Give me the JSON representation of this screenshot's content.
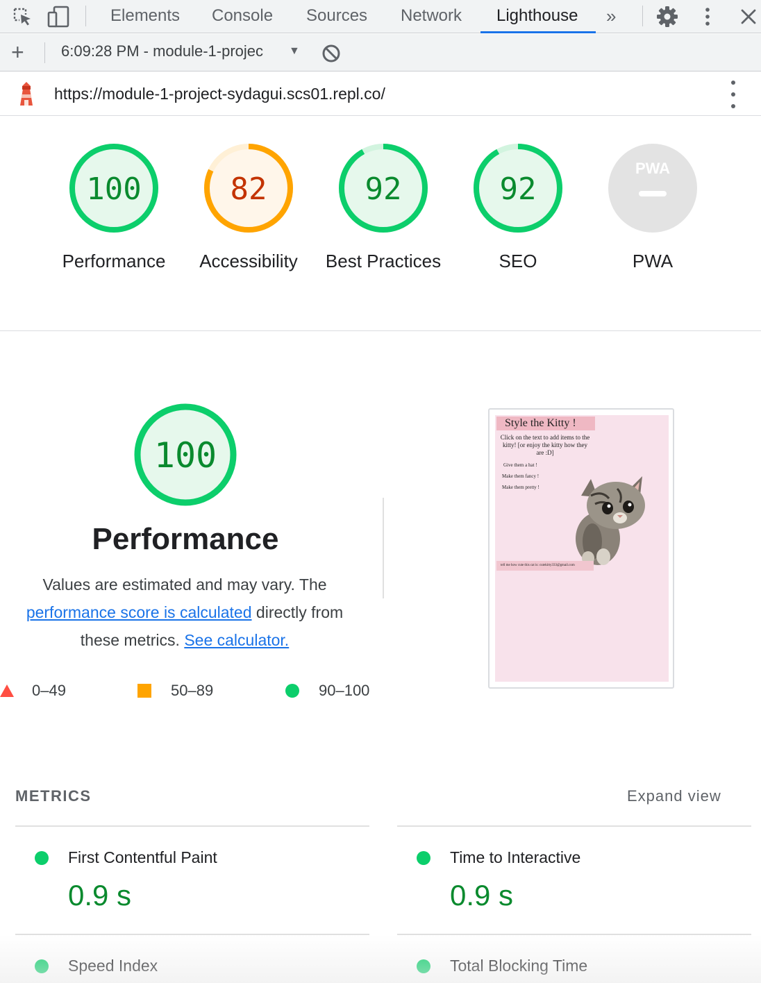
{
  "devtools": {
    "tabs": [
      {
        "label": "Elements"
      },
      {
        "label": "Console"
      },
      {
        "label": "Sources"
      },
      {
        "label": "Network"
      },
      {
        "label": "Lighthouse"
      }
    ],
    "more_tabs_glyph": "»",
    "active_tab": "Lighthouse",
    "icons": [
      "inspect-element-icon",
      "device-toolbar-icon",
      "chevron-double-right-icon",
      "gear-icon",
      "kebab-menu-icon",
      "close-icon"
    ]
  },
  "lighthouse_toolbar": {
    "add_glyph": "+",
    "report_select": "6:09:28 PM - module-1-projec",
    "clear_icon": "block-icon"
  },
  "url_bar": {
    "url": "https://module-1-project-sydagui.scs01.repl.co/"
  },
  "scores": [
    {
      "value": "100",
      "label": "Performance",
      "score": 100,
      "status": "pass"
    },
    {
      "value": "82",
      "label": "Accessibility",
      "score": 82,
      "status": "average"
    },
    {
      "value": "92",
      "label": "Best Practices",
      "score": 92,
      "status": "pass"
    },
    {
      "value": "92",
      "label": "SEO",
      "score": 92,
      "status": "pass"
    },
    {
      "value": "",
      "label": "PWA",
      "badge": "PWA",
      "status": "na"
    }
  ],
  "performance": {
    "score": "100",
    "title": "Performance",
    "desc_prefix": "Values are estimated and may vary. The ",
    "desc_link1": "performance score is calculated",
    "desc_middle": " directly from these metrics. ",
    "desc_link2": "See calculator."
  },
  "legend": [
    {
      "range": "0–49",
      "shape": "triangle",
      "color": "#ff4e42"
    },
    {
      "range": "50–89",
      "shape": "square",
      "color": "#ffa400"
    },
    {
      "range": "90–100",
      "shape": "circle",
      "color": "#0cce6b"
    }
  ],
  "thumbnail": {
    "title": "Style the Kitty !",
    "intro": "Click on the text to add items to the kitty! [or enjoy the kitty how they are :D]",
    "items": [
      "Give them a hat !",
      "Make them fancy !",
      "Make them pretty !"
    ],
    "footer": "tell me how cute this cat is: cutekitty333@gmail.com"
  },
  "metrics": {
    "heading": "METRICS",
    "expand_label": "Expand view",
    "items": [
      {
        "label": "First Contentful Paint",
        "value": "0.9 s"
      },
      {
        "label": "Time to Interactive",
        "value": "0.9 s"
      },
      {
        "label": "Speed Index",
        "value": ""
      },
      {
        "label": "Total Blocking Time",
        "value": ""
      }
    ]
  },
  "colors": {
    "pass": "#0cce6b",
    "pass_text": "#0a8a2e",
    "average": "#ffa400",
    "average_text": "#c33300",
    "fail": "#ff4e42",
    "link": "#1a73e8"
  }
}
